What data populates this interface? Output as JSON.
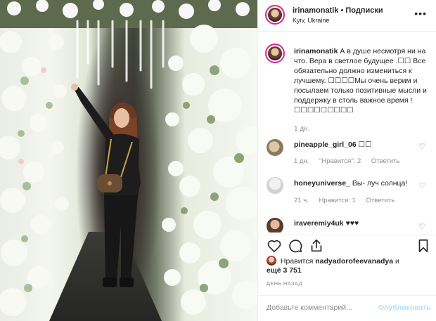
{
  "header": {
    "username": "irinamonatik",
    "separator": "•",
    "follow_label": "Подписки",
    "location": "Kyiv, Ukraine",
    "more_icon": "more-horizontal-icon"
  },
  "caption": {
    "username": "irinamonatik",
    "text": "А в душе несмотря ни на что. Вера в светлое будущее .☐☐ Все обязательно должно измениться к лучшему. ☐☐☐☐Мы очень верим и посылаем только позитивные мысли и поддержку в столь важное время ! ☐☐☐☐☐☐☐☐☐",
    "time": "1 дн."
  },
  "comments": [
    {
      "username": "pineapple_girl_06",
      "text": "☐☐",
      "time": "1 дн.",
      "likes": "\"Нравится\": 2",
      "reply": "Ответить"
    },
    {
      "username": "honeyuniverse_",
      "text": "Вы- луч солнца!",
      "time": "21 ч.",
      "likes": "Нравится: 1",
      "reply": "Ответить"
    },
    {
      "username": "iraveremiy4uk",
      "text": "♥♥♥",
      "time": "",
      "likes": "",
      "reply": ""
    }
  ],
  "actions": {
    "like_icon": "heart-icon",
    "comment_icon": "comment-icon",
    "share_icon": "share-icon",
    "save_icon": "bookmark-icon"
  },
  "likes": {
    "prefix": "Нравится",
    "user": "nadyadorofeevanadya",
    "suffix": "и",
    "others": "ещё 3 751"
  },
  "date": "ДЕНЬ НАЗАД",
  "add_comment": {
    "placeholder": "Добавьте комментарий...",
    "post_label": "Опубликовать"
  },
  "colors": {
    "accent": "#0095f6",
    "post_disabled": "#b2dffc",
    "muted": "#8e8e8e",
    "border": "#efefef",
    "avatar_ring": "#d6249f"
  }
}
